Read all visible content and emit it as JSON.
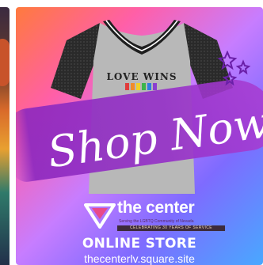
{
  "banner": {
    "shirt_text": "LOVE WINS",
    "headline": "Shop Now!",
    "brand_name": "the center",
    "tagline": "Serving the LGBTQ Community of Nevada",
    "badge": "CELEBRATING 30 YEARS OF SERVICE",
    "store_label": "ONLINE STORE",
    "url": "thecenterlv.square.site"
  },
  "colors": {
    "gradient_start": "#ff7a3d",
    "gradient_mid": "#c77dff",
    "gradient_end": "#49a8ff",
    "brush": "#9b3ccf",
    "shirt_body": "#b9b9b9",
    "shirt_sleeves": "#2b2b2b",
    "star_outline": "#6a1fa8"
  },
  "icons": {
    "star": "star-icon",
    "heart": "heart-icon",
    "logo": "triangle-logo-icon"
  }
}
